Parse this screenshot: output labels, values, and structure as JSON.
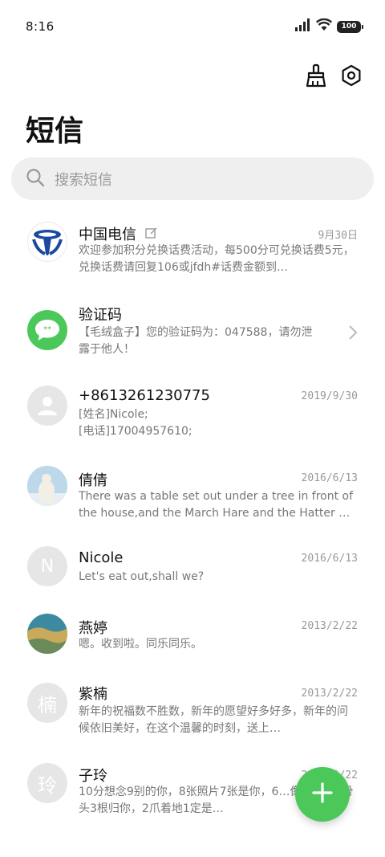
{
  "status_bar": {
    "time": "8:16",
    "battery": "100"
  },
  "header": {
    "title": "短信"
  },
  "search": {
    "placeholder": "搜索短信"
  },
  "messages": [
    {
      "name": "中国电信",
      "date": "9月30日",
      "preview": "欢迎参加积分兑换话费活动，每500分可兑换话费5元，兑换话费请回复106或jfdh#话费金额到…",
      "avatar": "china-telecom-logo-icon"
    },
    {
      "name": "验证码",
      "date": "",
      "preview": "【毛绒盒子】您的验证码为：047588，请勿泄露于他人！",
      "avatar": "chat-bubble-icon"
    },
    {
      "name": "+8613261230775",
      "date": "2019/9/30",
      "preview": "[姓名]Nicole;\n[电话]17004957610;",
      "avatar": "person-icon"
    },
    {
      "name": "倩倩",
      "date": "2016/6/13",
      "preview": "There was a table set out under a tree in front of the house,and the March Hare and the Hatter were …",
      "avatar": "polar-bear-photo"
    },
    {
      "name": "Nicole",
      "date": "2016/6/13",
      "preview": "Let's eat out,shall we?",
      "avatar": "N"
    },
    {
      "name": "燕婷",
      "date": "2013/2/22",
      "preview": "嗯。收到啦。同乐同乐。",
      "avatar": "landscape-photo"
    },
    {
      "name": "紫楠",
      "date": "2013/2/22",
      "preview": "新年的祝福数不胜数，新年的愿望好多好多，新年的问候依旧美好，在这个温馨的时刻，送上…",
      "avatar": "楠"
    },
    {
      "name": "子玲",
      "date": "2013/2/22",
      "preview": "10分想念9别的你，8张照片7张是你，6…像你，4根骨头3根归你，2爪着地1定是…",
      "avatar": "玲"
    }
  ],
  "colors": {
    "accent_green": "#4cc85a",
    "telecom_blue": "#1a4aa0",
    "avatar_grey": "#e6e6e6"
  }
}
